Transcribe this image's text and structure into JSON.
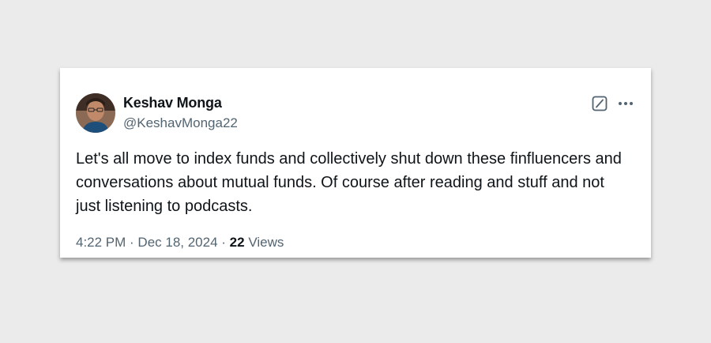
{
  "tweet": {
    "author": {
      "name": "Keshav Monga",
      "handle": "@KeshavMonga22"
    },
    "text": "Let's all move to index funds and collectively shut down these finfluencers and conversations about mutual funds. Of course after reading and stuff and not just listening to podcasts.",
    "time": "4:22 PM",
    "separator": " · ",
    "date": "Dec 18, 2024",
    "views_count": "22",
    "views_label": "Views"
  },
  "icons": {
    "grok": "grok-icon",
    "more": "more-icon"
  },
  "colors": {
    "text_primary": "#0f1419",
    "text_secondary": "#536471",
    "background": "#ebebeb",
    "card": "#ffffff"
  }
}
